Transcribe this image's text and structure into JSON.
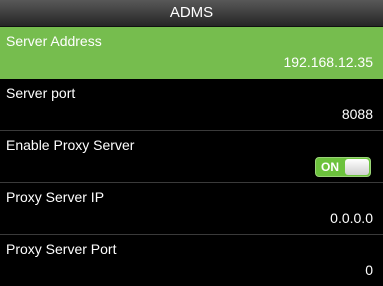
{
  "header": {
    "title": "ADMS"
  },
  "items": [
    {
      "label": "Server Address",
      "value": "192.168.12.35"
    },
    {
      "label": "Server port",
      "value": "8088"
    },
    {
      "label": "Enable Proxy Server",
      "toggle_text": "ON",
      "toggle_state": true
    },
    {
      "label": "Proxy Server IP",
      "value": "0.0.0.0"
    },
    {
      "label": "Proxy Server Port",
      "value": "0"
    }
  ],
  "colors": {
    "selected": "#76bd4e",
    "toggle_on": "#6cc23d"
  }
}
